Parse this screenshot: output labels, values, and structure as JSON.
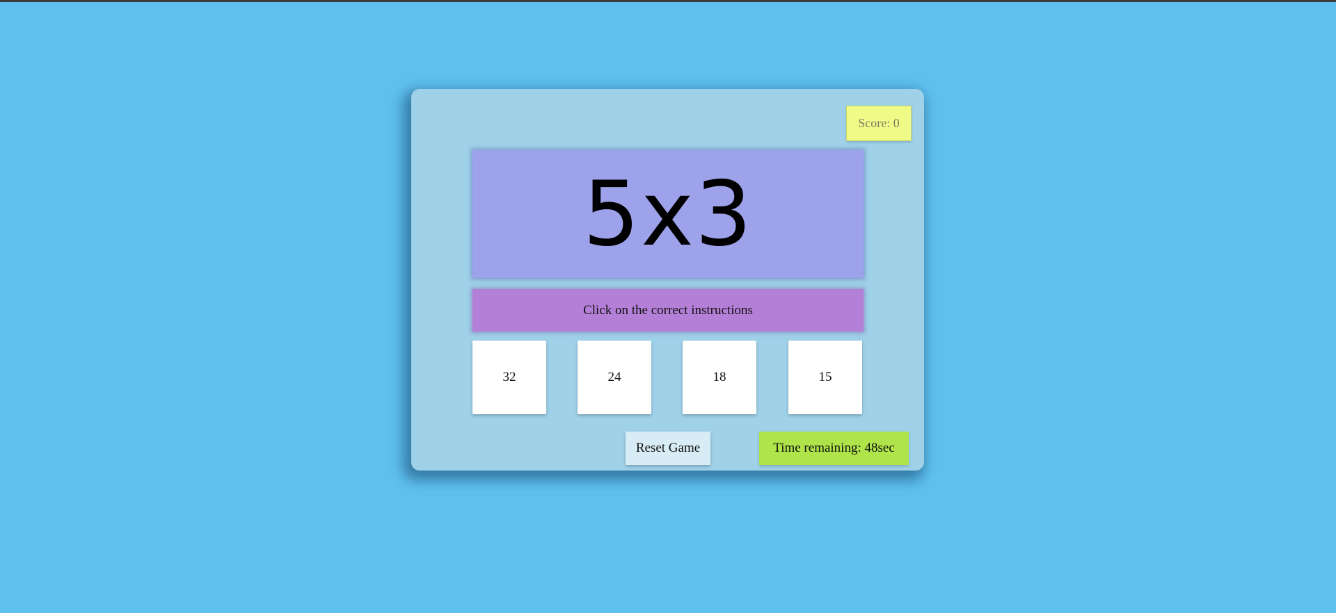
{
  "game": {
    "score_label": "Score: 0",
    "question": "5x3",
    "instruction": "Click on the correct instructions",
    "choices": [
      "32",
      "24",
      "18",
      "15"
    ],
    "reset_label": "Reset Game",
    "timer_label": "Time remaining: 48sec"
  },
  "colors": {
    "page_background": "#5fc0ee",
    "container_background": "#9fd1e9",
    "score_background": "#f0fa86",
    "question_background": "#9da2eb",
    "instruction_background": "#b47fd6",
    "choice_background": "#ffffff",
    "reset_background": "#d8ecf5",
    "timer_background": "#afe44a"
  }
}
